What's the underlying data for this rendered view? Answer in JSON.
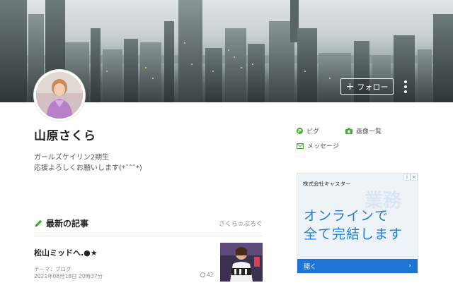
{
  "header": {
    "follow_label": "フォロー",
    "follow_icon": "plus-icon",
    "more_icon": "more-vertical-icon"
  },
  "profile": {
    "name": "山原さくら",
    "description_line1": "ガールズケイリン2期生",
    "description_line2": "応援よろしくお願いします(*ˆˆˆ*)"
  },
  "side_links": {
    "pigg": "ピグ",
    "image_list": "画像一覧",
    "message": "メッセージ"
  },
  "latest": {
    "title": "最新の記事",
    "blog_link": "さくら♔ぶろぐ",
    "article": {
      "title": "松山ミッドへ.●★",
      "theme": "テーマ：ブログ",
      "date": "2021年08月18日 20時37分",
      "count": "42"
    }
  },
  "ad": {
    "company": "株式会社キャスター",
    "bg_text": "業務",
    "headline_line1": "オンラインで",
    "headline_line2": "全て完結します",
    "cta": "開く",
    "cta_arrow": "›",
    "info_badge": "i",
    "close_badge": "×"
  },
  "colors": {
    "accent_green": "#3dae2b",
    "ad_blue": "#1e75d6"
  }
}
